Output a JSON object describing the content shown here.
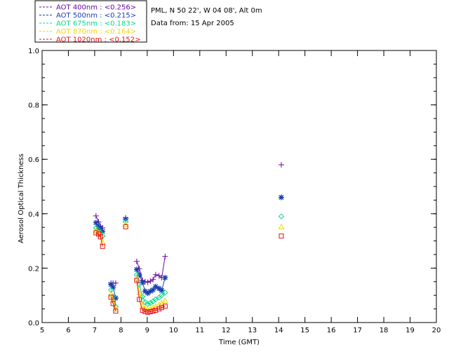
{
  "info": {
    "site": "PML, N 50 22', W 04 08', Alt 0m",
    "date": "Data from: 15 Apr 2005"
  },
  "legend": [
    {
      "label": "AOT  400nm : <0.256>",
      "color": "#6a0aa0"
    },
    {
      "label": "AOT  500nm : <0.215>",
      "color": "#1a3fb0"
    },
    {
      "label": "AOT  675nm : <0.183>",
      "color": "#00d88a"
    },
    {
      "label": "AOT  870nm : <0.164>",
      "color": "#f0d800"
    },
    {
      "label": "AOT 1020nm : <0.152>",
      "color": "#e8121b"
    }
  ],
  "chart_data": {
    "type": "scatter",
    "xlabel": "Time (GMT)",
    "ylabel": "Aerosol Optical Thickness",
    "xlim": [
      5,
      20
    ],
    "ylim": [
      0.0,
      1.0
    ],
    "xticks": [
      "5",
      "6",
      "7",
      "8",
      "9",
      "10",
      "11",
      "12",
      "13",
      "14",
      "15",
      "16",
      "17",
      "18",
      "19",
      "20"
    ],
    "yticks": [
      "0.0",
      "0.2",
      "0.4",
      "0.6",
      "0.8",
      "1.0"
    ],
    "series": [
      {
        "name": "AOT 400nm",
        "marker": "plus",
        "color": "#6a0aa0",
        "segments": [
          [
            [
              7.05,
              0.392
            ],
            [
              7.15,
              0.37
            ],
            [
              7.22,
              0.355
            ],
            [
              7.3,
              0.348
            ]
          ],
          [
            [
              7.62,
              0.145
            ],
            [
              7.7,
              0.145
            ],
            [
              7.8,
              0.145
            ]
          ],
          [
            [
              8.18,
              0.385
            ]
          ],
          [
            [
              8.6,
              0.225
            ],
            [
              8.7,
              0.198
            ],
            [
              8.82,
              0.155
            ],
            [
              8.92,
              0.15
            ],
            [
              9.02,
              0.148
            ],
            [
              9.12,
              0.152
            ],
            [
              9.22,
              0.158
            ],
            [
              9.32,
              0.176
            ],
            [
              9.45,
              0.172
            ],
            [
              9.55,
              0.165
            ],
            [
              9.68,
              0.243
            ]
          ],
          [
            [
              14.1,
              0.58
            ]
          ]
        ]
      },
      {
        "name": "AOT 500nm",
        "marker": "asterisk",
        "color": "#1a3fb0",
        "segments": [
          [
            [
              7.05,
              0.367
            ],
            [
              7.15,
              0.352
            ],
            [
              7.22,
              0.345
            ],
            [
              7.3,
              0.335
            ]
          ],
          [
            [
              7.62,
              0.14
            ],
            [
              7.7,
              0.13
            ],
            [
              7.8,
              0.09
            ]
          ],
          [
            [
              8.18,
              0.38
            ]
          ],
          [
            [
              8.6,
              0.195
            ],
            [
              8.7,
              0.175
            ],
            [
              8.82,
              0.148
            ],
            [
              8.92,
              0.115
            ],
            [
              9.02,
              0.108
            ],
            [
              9.12,
              0.115
            ],
            [
              9.22,
              0.12
            ],
            [
              9.32,
              0.132
            ],
            [
              9.45,
              0.125
            ],
            [
              9.55,
              0.118
            ],
            [
              9.68,
              0.165
            ]
          ],
          [
            [
              14.1,
              0.46
            ]
          ]
        ]
      },
      {
        "name": "AOT 675nm",
        "marker": "diamond",
        "color": "#00d88a",
        "segments": [
          [
            [
              7.05,
              0.348
            ],
            [
              7.15,
              0.34
            ],
            [
              7.22,
              0.33
            ],
            [
              7.3,
              0.318
            ]
          ],
          [
            [
              7.62,
              0.12
            ],
            [
              7.7,
              0.095
            ],
            [
              7.8,
              0.058
            ]
          ],
          [
            [
              8.18,
              0.37
            ]
          ],
          [
            [
              8.6,
              0.175
            ],
            [
              8.7,
              0.14
            ],
            [
              8.82,
              0.095
            ],
            [
              8.92,
              0.075
            ],
            [
              9.02,
              0.068
            ],
            [
              9.12,
              0.072
            ],
            [
              9.22,
              0.078
            ],
            [
              9.32,
              0.085
            ],
            [
              9.45,
              0.092
            ],
            [
              9.55,
              0.1
            ],
            [
              9.68,
              0.11
            ]
          ],
          [
            [
              14.1,
              0.39
            ]
          ]
        ]
      },
      {
        "name": "AOT 870nm",
        "marker": "triangle",
        "color": "#f0d800",
        "segments": [
          [
            [
              7.05,
              0.338
            ],
            [
              7.15,
              0.33
            ],
            [
              7.22,
              0.32
            ],
            [
              7.3,
              0.295
            ]
          ],
          [
            [
              7.62,
              0.105
            ],
            [
              7.7,
              0.082
            ],
            [
              7.8,
              0.05
            ]
          ],
          [
            [
              8.18,
              0.36
            ]
          ],
          [
            [
              8.6,
              0.16
            ],
            [
              8.7,
              0.11
            ],
            [
              8.82,
              0.065
            ],
            [
              8.92,
              0.052
            ],
            [
              9.02,
              0.048
            ],
            [
              9.12,
              0.05
            ],
            [
              9.22,
              0.055
            ],
            [
              9.32,
              0.06
            ],
            [
              9.45,
              0.065
            ],
            [
              9.55,
              0.072
            ],
            [
              9.68,
              0.08
            ]
          ],
          [
            [
              14.1,
              0.352
            ]
          ]
        ]
      },
      {
        "name": "AOT 1020nm",
        "marker": "square",
        "color": "#e8121b",
        "segments": [
          [
            [
              7.05,
              0.33
            ],
            [
              7.15,
              0.325
            ],
            [
              7.22,
              0.315
            ],
            [
              7.3,
              0.28
            ]
          ],
          [
            [
              7.62,
              0.093
            ],
            [
              7.7,
              0.07
            ],
            [
              7.8,
              0.042
            ]
          ],
          [
            [
              8.18,
              0.352
            ]
          ],
          [
            [
              8.6,
              0.155
            ],
            [
              8.7,
              0.085
            ],
            [
              8.82,
              0.045
            ],
            [
              8.92,
              0.04
            ],
            [
              9.02,
              0.038
            ],
            [
              9.12,
              0.04
            ],
            [
              9.22,
              0.042
            ],
            [
              9.32,
              0.045
            ],
            [
              9.45,
              0.05
            ],
            [
              9.55,
              0.055
            ],
            [
              9.68,
              0.06
            ]
          ],
          [
            [
              14.1,
              0.318
            ]
          ]
        ]
      }
    ]
  }
}
